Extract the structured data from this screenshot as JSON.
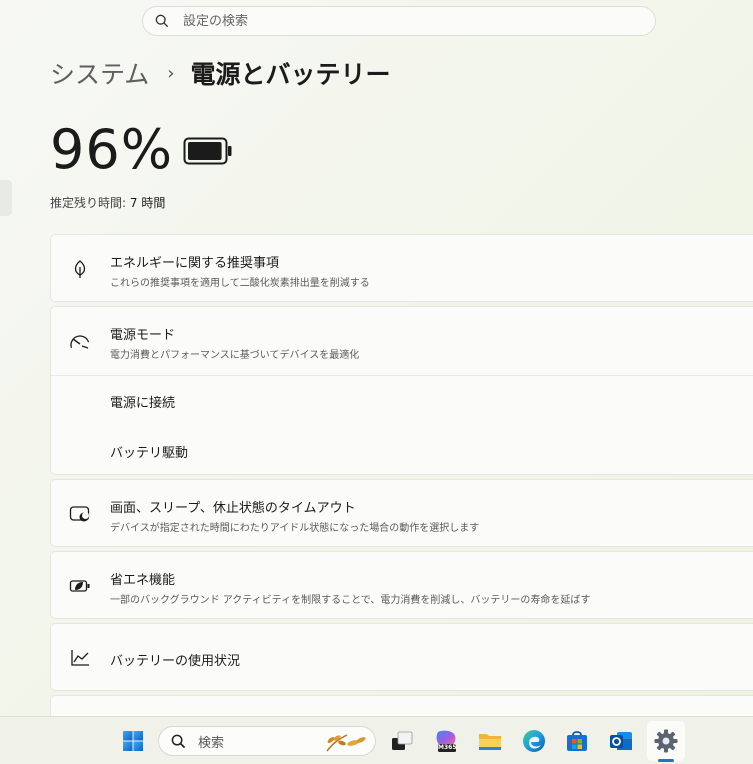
{
  "search": {
    "placeholder": "設定の検索"
  },
  "breadcrumb": {
    "parent": "システム",
    "separator": "›",
    "current": "電源とバッテリー"
  },
  "battery": {
    "percent_text": "96%",
    "percent": 96,
    "remaining_label": "推定残り時間:",
    "remaining_value": "7 時間"
  },
  "cards": {
    "recommendations": {
      "title": "エネルギーに関する推奨事項",
      "subtitle": "これらの推奨事項を適用して二酸化炭素排出量を削減する",
      "icon": "leaf-icon"
    },
    "power_mode": {
      "title": "電源モード",
      "subtitle": "電力消費とパフォーマンスに基づいてデバイスを最適化",
      "icon": "gauge-icon",
      "sub_rows": [
        {
          "label": "電源に接続"
        },
        {
          "label": "バッテリ駆動"
        }
      ]
    },
    "timeouts": {
      "title": "画面、スリープ、休止状態のタイムアウト",
      "subtitle": "デバイスが指定された時間にわたりアイドル状態になった場合の動作を選択します",
      "icon": "screen-sleep-icon"
    },
    "energy_saver": {
      "title": "省エネ機能",
      "subtitle": "一部のバックグラウンド アクティビティを制限することで、電力消費を削減し、バッテリーの寿命を延ばす",
      "icon": "battery-saver-icon"
    },
    "usage": {
      "title": "バッテリーの使用状況",
      "icon": "chart-line-icon"
    }
  },
  "taskbar": {
    "search_label": "検索",
    "apps": [
      "windows-start-icon",
      "task-view-icon",
      "m365-icon",
      "file-explorer-icon",
      "edge-icon",
      "store-icon",
      "outlook-icon",
      "settings-icon"
    ],
    "m365_text": "M365"
  },
  "colors": {
    "accent": "#2b6fc5",
    "background": "#f1f5e9"
  }
}
